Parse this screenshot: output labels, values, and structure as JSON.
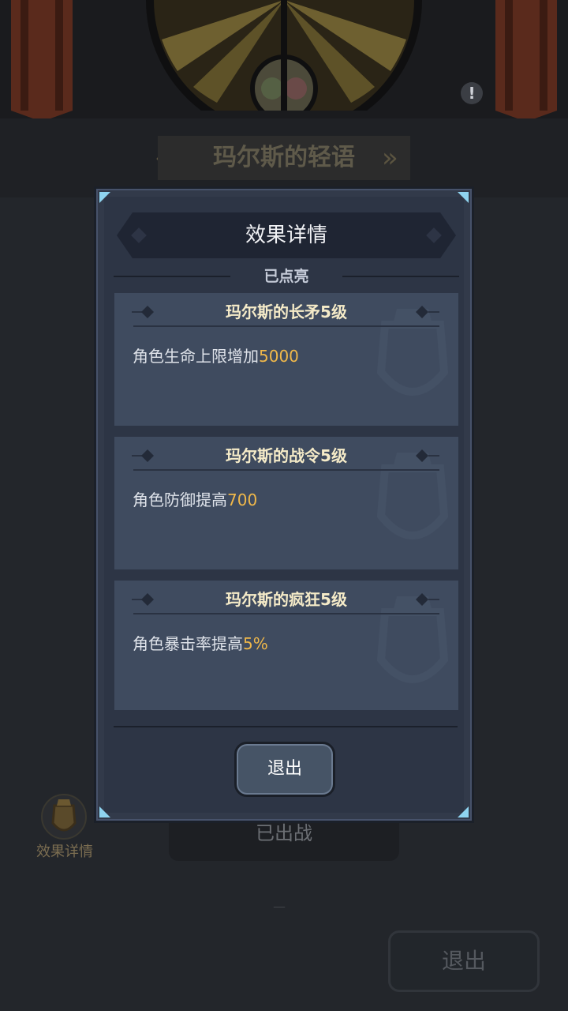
{
  "background": {
    "stage_title": "玛尔斯的轻语",
    "deployed_label": "已出战",
    "effect_details_label": "效果详情",
    "exit_label": "退出",
    "alert_symbol": "!"
  },
  "modal": {
    "title": "效果详情",
    "section_label": "已点亮",
    "effects": [
      {
        "title": "玛尔斯的长矛5级",
        "desc": "角色生命上限增加",
        "value": "5000"
      },
      {
        "title": "玛尔斯的战令5级",
        "desc": "角色防御提高",
        "value": "700"
      },
      {
        "title": "玛尔斯的疯狂5级",
        "desc": "角色暴击率提高",
        "value": "5%"
      }
    ],
    "exit_button": "退出"
  },
  "colors": {
    "modal_bg": "#2d3545",
    "card_bg": "#3f4b5f",
    "title_gold": "#f5ebc8",
    "value_orange": "#f0b84a",
    "corner_accent": "#8fd4f0"
  },
  "icons": [
    "alert-icon",
    "effect-shield-icon",
    "diamond-ornament-icon",
    "shield-watermark-icon",
    "double-chevron-left-icon",
    "double-chevron-right-icon"
  ]
}
